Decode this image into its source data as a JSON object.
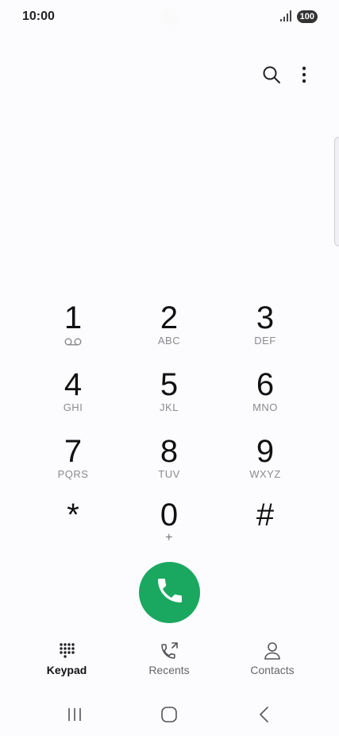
{
  "status_bar": {
    "time": "10:00",
    "battery": "100",
    "signal_icon": "signal-bars-icon"
  },
  "top_actions": {
    "search_icon": "search-icon",
    "more_icon": "more-vertical-icon"
  },
  "keypad": {
    "keys": [
      {
        "digit": "1",
        "letters": ""
      },
      {
        "digit": "2",
        "letters": "ABC"
      },
      {
        "digit": "3",
        "letters": "DEF"
      },
      {
        "digit": "4",
        "letters": "GHI"
      },
      {
        "digit": "5",
        "letters": "JKL"
      },
      {
        "digit": "6",
        "letters": "MNO"
      },
      {
        "digit": "7",
        "letters": "PQRS"
      },
      {
        "digit": "8",
        "letters": "TUV"
      },
      {
        "digit": "9",
        "letters": "WXYZ"
      },
      {
        "digit": "*",
        "letters": ""
      },
      {
        "digit": "0",
        "letters": "+"
      },
      {
        "digit": "#",
        "letters": ""
      }
    ]
  },
  "call_button": {
    "icon": "phone-icon",
    "color": "#1aa860"
  },
  "tabs": [
    {
      "label": "Keypad",
      "icon": "keypad-icon",
      "active": true
    },
    {
      "label": "Recents",
      "icon": "recents-call-icon",
      "active": false
    },
    {
      "label": "Contacts",
      "icon": "contact-person-icon",
      "active": false
    }
  ],
  "nav_bar": {
    "recent_apps_icon": "recent-apps-icon",
    "home_icon": "home-icon",
    "back_icon": "back-icon"
  }
}
